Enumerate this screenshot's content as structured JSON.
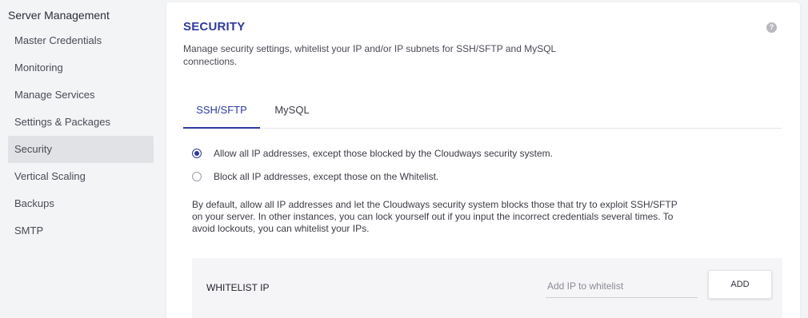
{
  "sidebar": {
    "title": "Server Management",
    "items": [
      {
        "label": "Master Credentials"
      },
      {
        "label": "Monitoring"
      },
      {
        "label": "Manage Services"
      },
      {
        "label": "Settings & Packages"
      },
      {
        "label": "Security",
        "active": true
      },
      {
        "label": "Vertical Scaling"
      },
      {
        "label": "Backups"
      },
      {
        "label": "SMTP"
      }
    ]
  },
  "panel": {
    "title": "SECURITY",
    "help_icon": "?",
    "description": "Manage security settings, whitelist your IP and/or IP subnets for SSH/SFTP and MySQL connections."
  },
  "tabs": [
    {
      "label": "SSH/SFTP",
      "active": true
    },
    {
      "label": "MySQL",
      "active": false
    }
  ],
  "access_options": [
    {
      "label": "Allow all IP addresses, except those blocked by the Cloudways security system.",
      "selected": true
    },
    {
      "label": "Block all IP addresses, except those on the Whitelist.",
      "selected": false
    }
  ],
  "explanation": "By default, allow all IP addresses and let the Cloudways security system blocks those that try to exploit SSH/SFTP on your server. In other instances, you can lock yourself out if you input the incorrect credentials several times. To avoid lockouts, you can whitelist your IPs.",
  "whitelist": {
    "label": "WHITELIST IP",
    "input_value": "",
    "input_placeholder": "Add IP to whitelist",
    "add_label": "ADD"
  },
  "colors": {
    "accent": "#2f3a9e",
    "sidebar_active_bg": "#e1e2e5",
    "page_bg": "#f3f4f6"
  }
}
